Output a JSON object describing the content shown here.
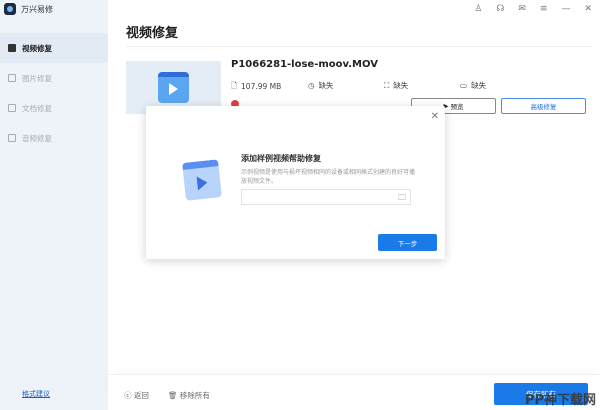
{
  "app": {
    "name": "万兴易修"
  },
  "sidebar": {
    "items": [
      {
        "label": "视频修复"
      },
      {
        "label": "图片修复"
      },
      {
        "label": "文档修复"
      },
      {
        "label": "音频修复"
      }
    ],
    "format_link": "格式建议"
  },
  "header": {
    "title": "视频修复",
    "icons": [
      "user-icon",
      "headset-icon",
      "mail-icon",
      "menu-icon",
      "minimize-icon",
      "close-icon"
    ]
  },
  "file": {
    "name": "P1066281-lose-moov.MOV",
    "size": "107.99 MB",
    "duration": "缺失",
    "resolution": "缺失",
    "codec": "缺失",
    "preview_label": "预览",
    "advanced_label": "高级修复"
  },
  "modal": {
    "title": "添加样例视频帮助修复",
    "description": "示例视频是使用与损坏视频相同的设备或相同格式创建的良好可播放视频文件。",
    "input_value": "",
    "next_label": "下一步"
  },
  "footer": {
    "back_label": "返回",
    "remove_label": "移除所有",
    "save_label": "保存所有"
  },
  "watermark": "PP神下载网"
}
